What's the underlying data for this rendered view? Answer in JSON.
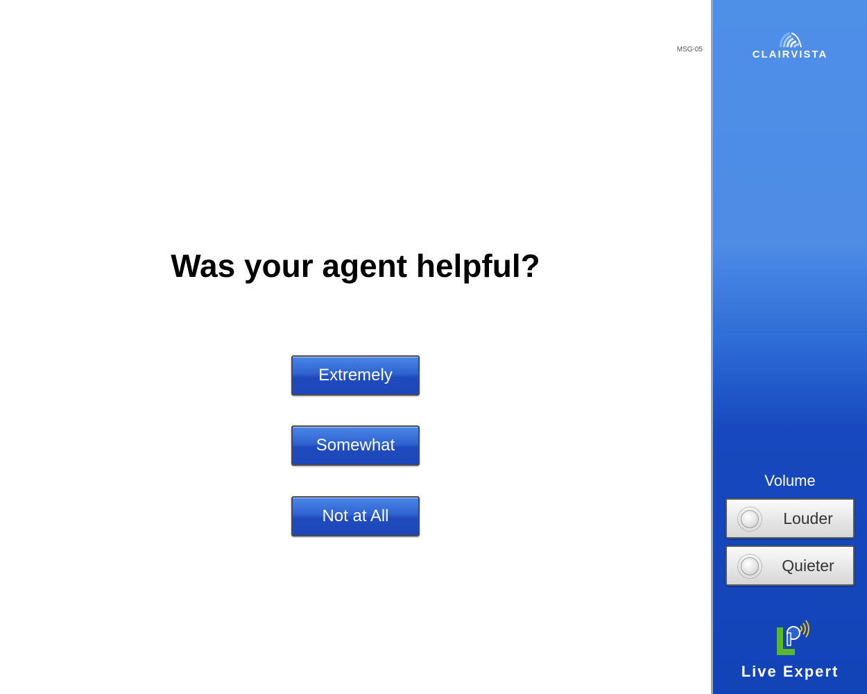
{
  "screen_code": "MSG-05",
  "question": "Was your agent helpful?",
  "answers": [
    {
      "label": "Extremely"
    },
    {
      "label": "Somewhat"
    },
    {
      "label": "Not at All"
    }
  ],
  "sidebar": {
    "brand": "CLAIRVISTA",
    "volume": {
      "label": "Volume",
      "louder_label": "Louder",
      "quieter_label": "Quieter"
    },
    "product_name": "Live Expert"
  },
  "colors": {
    "sidebar_blue": "#2c6ad6",
    "button_blue": "#2f63d0",
    "logo_green": "#5ab82e"
  }
}
